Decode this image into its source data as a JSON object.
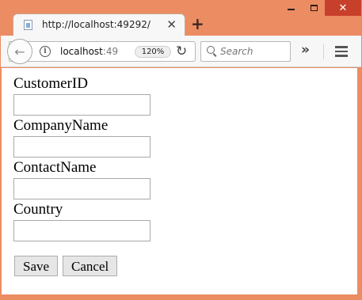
{
  "window": {
    "controls": {
      "minimize": "",
      "maximize": "",
      "close": "✕"
    }
  },
  "tab": {
    "title": "http://localhost:49292/",
    "close_icon": "✕"
  },
  "new_tab_icon": "+",
  "toolbar": {
    "back_icon": "←",
    "info_icon": "i",
    "url_host": "localhost",
    "url_port": ":49",
    "zoom": "120%",
    "reload_icon": "↻",
    "search_placeholder": "Search",
    "overflow_icon": "»"
  },
  "form": {
    "fields": [
      {
        "label": "CustomerID",
        "value": ""
      },
      {
        "label": "CompanyName",
        "value": ""
      },
      {
        "label": "ContactName",
        "value": ""
      },
      {
        "label": "Country",
        "value": ""
      }
    ],
    "save_label": "Save",
    "cancel_label": "Cancel"
  },
  "colors": {
    "window_frame": "#ec8c63",
    "close_button": "#c7402b",
    "toolbar_bg": "#f7f7f7",
    "button_bg": "#e6e6e6"
  }
}
